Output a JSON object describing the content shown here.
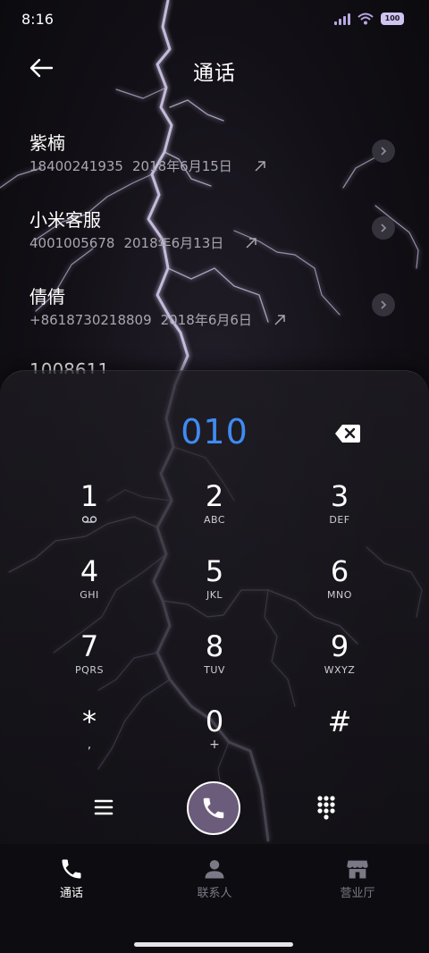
{
  "status_bar": {
    "time": "8:16",
    "battery_text": "100",
    "icons": [
      "signal-icon",
      "wifi-icon",
      "battery-icon"
    ]
  },
  "header": {
    "title": "通话",
    "back_icon": "arrow-left-icon"
  },
  "call_log": [
    {
      "name": "紫楠",
      "number": "18400241935",
      "date": "2018年6月15日",
      "direction": "outgoing"
    },
    {
      "name": "小米客服",
      "number": "4001005678",
      "date": "2018年6月13日",
      "direction": "outgoing"
    },
    {
      "name": "倩倩",
      "number": "+8618730218809",
      "date": "2018年6月6日",
      "direction": "outgoing"
    },
    {
      "name": "1008611",
      "number": "",
      "date": "",
      "direction": ""
    }
  ],
  "dialpad": {
    "input_value": "010",
    "keys": [
      {
        "digit": "1",
        "letters": "",
        "icon": "voicemail-icon"
      },
      {
        "digit": "2",
        "letters": "ABC"
      },
      {
        "digit": "3",
        "letters": "DEF"
      },
      {
        "digit": "4",
        "letters": "GHI"
      },
      {
        "digit": "5",
        "letters": "JKL"
      },
      {
        "digit": "6",
        "letters": "MNO"
      },
      {
        "digit": "7",
        "letters": "PQRS"
      },
      {
        "digit": "8",
        "letters": "TUV"
      },
      {
        "digit": "9",
        "letters": "WXYZ"
      },
      {
        "digit": "*",
        "letters": ","
      },
      {
        "digit": "0",
        "letters": "+"
      },
      {
        "digit": "#",
        "letters": ""
      }
    ],
    "actions": [
      "menu-icon",
      "phone-icon",
      "keypad-icon"
    ]
  },
  "bottom_nav": {
    "items": [
      {
        "label": "通话",
        "icon": "phone-icon",
        "active": true
      },
      {
        "label": "联系人",
        "icon": "person-icon",
        "active": false
      },
      {
        "label": "营业厅",
        "icon": "store-icon",
        "active": false
      }
    ]
  },
  "colors": {
    "accent": "#3f8bf2",
    "call_button": "#6c5c7b",
    "secondary_text": "#a9a6b0"
  }
}
